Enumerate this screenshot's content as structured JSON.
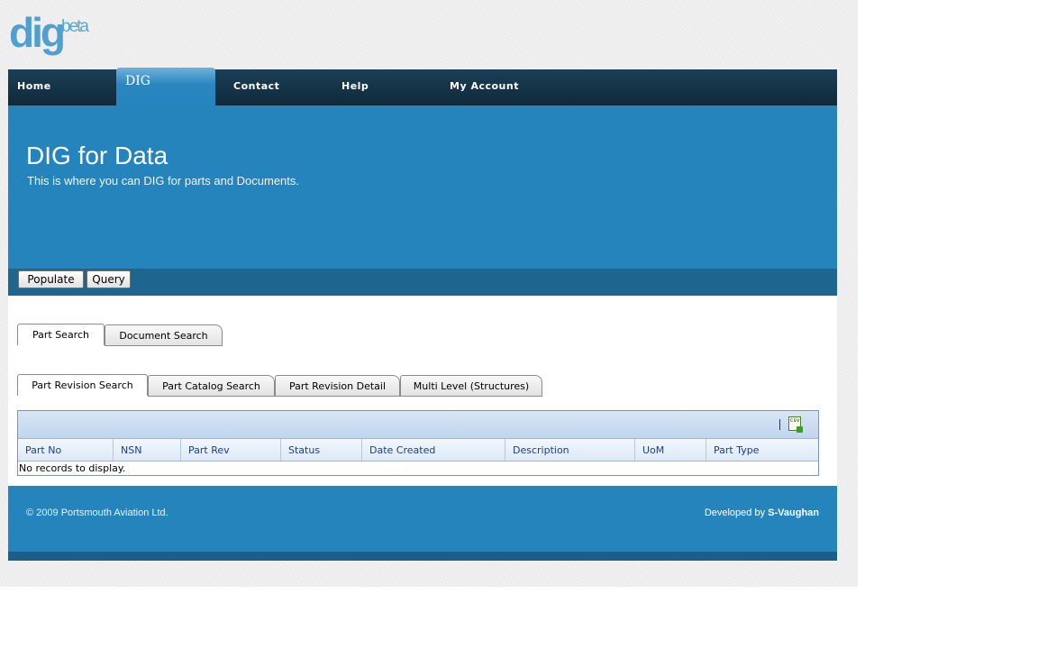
{
  "logo": {
    "main": "dig",
    "superscript": "beta"
  },
  "nav": {
    "items": [
      {
        "label": "Home"
      },
      {
        "label": "DIG",
        "selected": true
      },
      {
        "label": "Contact"
      },
      {
        "label": "Help"
      },
      {
        "label": "My Account"
      }
    ]
  },
  "banner": {
    "title": "DIG for Data",
    "subtitle": "This is where you can DIG for parts and Documents."
  },
  "toolbar": {
    "populate_label": "Populate",
    "query_label": "Query"
  },
  "search_tabs": [
    {
      "label": "Part Search",
      "selected": true
    },
    {
      "label": "Document Search",
      "selected": false
    }
  ],
  "part_tabs": [
    {
      "label": "Part Revision Search",
      "selected": true
    },
    {
      "label": "Part Catalog Search",
      "selected": false
    },
    {
      "label": "Part Revision Detail",
      "selected": false
    },
    {
      "label": "Multi Level (Structures)",
      "selected": false
    }
  ],
  "grid": {
    "export_icon": "csv-export-icon",
    "columns": [
      "Part No",
      "NSN",
      "Part Rev",
      "Status",
      "Date Created",
      "Description",
      "UoM",
      "Part Type"
    ],
    "empty_text": "No records to display."
  },
  "footer": {
    "copyright": "© 2009 Portsmouth Aviation Ltd.",
    "developed_prefix": "Developed by",
    "developer": "S-Vaughan"
  },
  "colors": {
    "nav_bg": "#10293a",
    "banner_bg": "#2584bb",
    "toolbar_bg": "#1e6590",
    "grid_header_text": "#1d3f80"
  }
}
